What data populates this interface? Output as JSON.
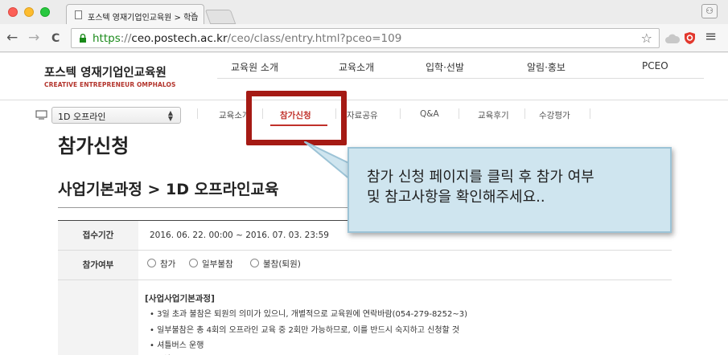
{
  "browser": {
    "tab_title": "포스텍 영재기업인교육원 > 학습",
    "tab_close": "×",
    "url_scheme": "https",
    "url_host": "ceo.postech.ac.kr",
    "url_path": "/ceo/class/entry.html?pceo=109",
    "url_prefix": "://",
    "back_icon": "←",
    "forward_icon": "→",
    "reload_icon": "C",
    "star_icon": "☆",
    "menu_icon": "≡",
    "profile_icon": "⚇"
  },
  "site": {
    "logo_title": "포스텍 영재기업인교육원",
    "logo_subtitle": "CREATIVE ENTREPRENEUR OMPHALOS",
    "main_nav": [
      "교육원 소개",
      "교육소개",
      "입학·선발",
      "알림·홍보",
      "PCEO"
    ],
    "course_select": "1D 오프라인",
    "sub_nav": [
      "교육소개",
      "참가신청",
      "자료공유",
      "Q&A",
      "교육후기",
      "수강평가"
    ],
    "page_title": "참가신청",
    "section_title": "사업기본과정 > 1D 오프라인교육"
  },
  "form": {
    "period_label": "접수기간",
    "period_value": "2016. 06. 22. 00:00 ~ 2016. 07. 03. 23:59",
    "participation_label": "참가여부",
    "options": [
      "참가",
      "일부불참",
      "불참(퇴원)"
    ],
    "notes_heading": "[사업사업기본과정]",
    "notes": [
      "3일 초과 불참은 퇴원의 의미가 있으니, 개별적으로 교육원에 연락바람(054-279-8252~3)",
      "일부불참은 총 4회의 오프라인 교육 중 2회만 가능하므로, 이를 반드시 숙지하고 신청할 것",
      "셔틀버스 운행"
    ]
  },
  "callout": {
    "line1": "참가 신청 페이지를 클릭 후 참가 여부",
    "line2": "및 참고사항을 확인해주세요.."
  },
  "colors": {
    "highlight": "#a51a14",
    "callout_bg": "#cfe5ef",
    "accent": "#c0302a"
  }
}
